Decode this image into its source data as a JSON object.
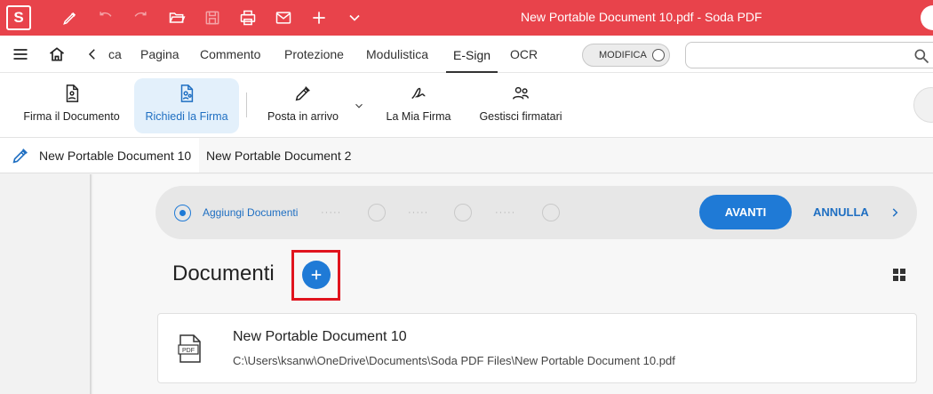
{
  "app": {
    "logo_letter": "S",
    "window_title": "New Portable Document 10.pdf   -   Soda PDF",
    "accent_color": "#e8434b",
    "primary_color": "#1f7ad6"
  },
  "toolbar_icons": [
    "pen-icon",
    "undo-icon",
    "redo-icon",
    "open-folder-icon",
    "save-icon",
    "print-icon",
    "mail-icon",
    "plus-icon",
    "chevron-down-icon"
  ],
  "menu": {
    "partial_tab": "ca",
    "tabs": [
      "Pagina",
      "Commento",
      "Protezione",
      "Modulistica",
      "E-Sign",
      "OCR"
    ],
    "active_tab": "E-Sign",
    "modifica_label": "MODIFICA",
    "search_placeholder": ""
  },
  "ribbon": {
    "items": [
      {
        "label": "Firma il Documento",
        "icon": "sign-document-icon"
      },
      {
        "label": "Richiedi la Firma",
        "icon": "request-signature-icon",
        "active": true
      },
      {
        "label": "Posta in arrivo",
        "icon": "inbox-pen-icon"
      },
      {
        "label": "La Mia Firma",
        "icon": "signature-icon"
      },
      {
        "label": "Gestisci firmatari",
        "icon": "signers-icon"
      }
    ]
  },
  "doc_tabs": [
    "New Portable Document 10",
    "New Portable Document 2"
  ],
  "stepper": {
    "active_step_label": "Aggiungi Documenti",
    "dots": "·····",
    "next_button": "AVANTI",
    "cancel_button": "ANNULLA"
  },
  "documents": {
    "heading": "Documenti",
    "items": [
      {
        "name": "New Portable Document 10",
        "path": "C:\\Users\\ksanw\\OneDrive\\Documents\\Soda PDF Files\\New Portable Document 10.pdf",
        "icon_text": "PDF"
      }
    ]
  }
}
